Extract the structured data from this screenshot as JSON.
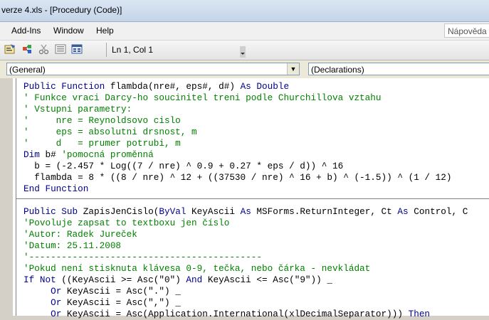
{
  "window": {
    "title": "verze 4.xls - [Procedury (Code)]"
  },
  "menu": {
    "items": [
      "Add-Ins",
      "Window",
      "Help"
    ],
    "help_placeholder": "Nápověda"
  },
  "toolbar": {
    "icons": [
      "properties-icon",
      "object-browser-icon",
      "cut-icon",
      "list-icon",
      "toolbox-icon"
    ],
    "position": "Ln 1, Col 1"
  },
  "combos": {
    "object": "(General)",
    "procedure": "(Declarations)"
  },
  "code": {
    "lines": [
      {
        "t": "code",
        "segs": [
          {
            "k": "kw",
            "s": "Public Function"
          },
          {
            "k": "",
            "s": " flambda(nre#, eps#, d#) "
          },
          {
            "k": "kw",
            "s": "As Double"
          }
        ]
      },
      {
        "t": "code",
        "segs": [
          {
            "k": "cm",
            "s": "' Funkce vraci Darcy-ho soucinitel treni podle Churchillova vztahu"
          }
        ]
      },
      {
        "t": "code",
        "segs": [
          {
            "k": "cm",
            "s": "' Vstupni parametry:"
          }
        ]
      },
      {
        "t": "code",
        "segs": [
          {
            "k": "cm",
            "s": "'     nre = Reynoldsovo cislo"
          }
        ]
      },
      {
        "t": "code",
        "segs": [
          {
            "k": "cm",
            "s": "'     eps = absolutni drsnost, m"
          }
        ]
      },
      {
        "t": "code",
        "segs": [
          {
            "k": "cm",
            "s": "'     d   = prumer potrubi, m"
          }
        ]
      },
      {
        "t": "code",
        "segs": [
          {
            "k": "kw",
            "s": "Dim"
          },
          {
            "k": "",
            "s": " b# "
          },
          {
            "k": "cm",
            "s": "'pomocná proměnná"
          }
        ]
      },
      {
        "t": "code",
        "segs": [
          {
            "k": "",
            "s": "  b = (-2.457 * Log((7 / nre) ^ 0.9 + 0.27 * eps / d)) ^ 16"
          }
        ]
      },
      {
        "t": "code",
        "segs": [
          {
            "k": "",
            "s": "  flambda = 8 * ((8 / nre) ^ 12 + ((37530 / nre) ^ 16 + b) ^ (-1.5)) ^ (1 / 12)"
          }
        ]
      },
      {
        "t": "code",
        "segs": [
          {
            "k": "kw",
            "s": "End Function"
          }
        ]
      },
      {
        "t": "sep"
      },
      {
        "t": "code",
        "segs": [
          {
            "k": "kw",
            "s": "Public Sub"
          },
          {
            "k": "",
            "s": " ZapisJenCislo("
          },
          {
            "k": "kw",
            "s": "ByVal"
          },
          {
            "k": "",
            "s": " KeyAscii "
          },
          {
            "k": "kw",
            "s": "As"
          },
          {
            "k": "",
            "s": " MSForms.ReturnInteger, Ct "
          },
          {
            "k": "kw",
            "s": "As"
          },
          {
            "k": "",
            "s": " Control, C"
          }
        ]
      },
      {
        "t": "code",
        "segs": [
          {
            "k": "cm",
            "s": "'Povoluje zapsat to textboxu jen číslo"
          }
        ]
      },
      {
        "t": "code",
        "segs": [
          {
            "k": "cm",
            "s": "'Autor: Radek Jureček"
          }
        ]
      },
      {
        "t": "code",
        "segs": [
          {
            "k": "cm",
            "s": "'Datum: 25.11.2008"
          }
        ]
      },
      {
        "t": "code",
        "segs": [
          {
            "k": "cm",
            "s": "'-------------------------------------------"
          }
        ]
      },
      {
        "t": "code",
        "segs": [
          {
            "k": "cm",
            "s": "'Pokud není stisknuta klávesa 0-9, tečka, nebo čárka - nevkládat"
          }
        ]
      },
      {
        "t": "code",
        "segs": [
          {
            "k": "kw",
            "s": "If Not"
          },
          {
            "k": "",
            "s": " ((KeyAscii >= Asc(\"0\") "
          },
          {
            "k": "kw",
            "s": "And"
          },
          {
            "k": "",
            "s": " KeyAscii <= Asc(\"9\")) _"
          }
        ]
      },
      {
        "t": "code",
        "segs": [
          {
            "k": "",
            "s": "     "
          },
          {
            "k": "kw",
            "s": "Or"
          },
          {
            "k": "",
            "s": " KeyAscii = Asc(\".\") _"
          }
        ]
      },
      {
        "t": "code",
        "segs": [
          {
            "k": "",
            "s": "     "
          },
          {
            "k": "kw",
            "s": "Or"
          },
          {
            "k": "",
            "s": " KeyAscii = Asc(\",\") _"
          }
        ]
      },
      {
        "t": "code",
        "segs": [
          {
            "k": "",
            "s": "     "
          },
          {
            "k": "kw",
            "s": "Or"
          },
          {
            "k": "",
            "s": " KeyAscii = Asc(Application.International(xlDecimalSeparator))) "
          },
          {
            "k": "kw",
            "s": "Then"
          }
        ]
      }
    ]
  }
}
